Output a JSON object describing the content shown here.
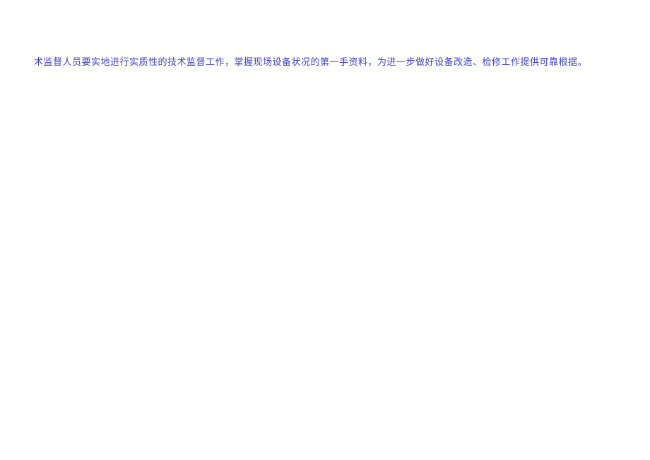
{
  "document": {
    "body_text": "术监督人员要实地进行实质性的技术监督工作，掌握现场设备状况的第一手资料，为进一步做好设备改造、检修工作提供可靠根据。"
  }
}
